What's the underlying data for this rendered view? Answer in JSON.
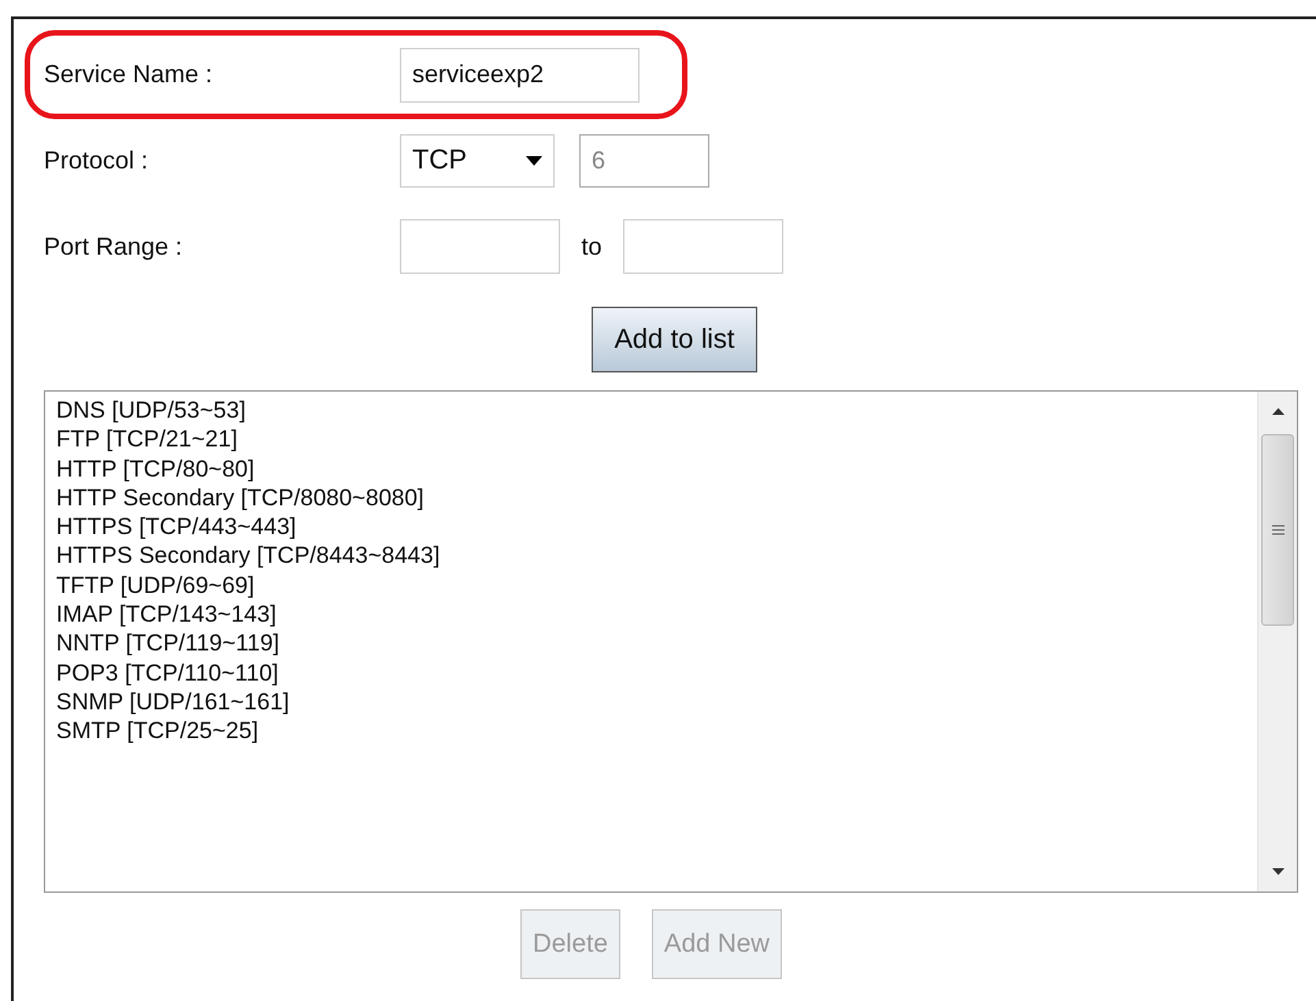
{
  "service_name": {
    "label": "Service Name :",
    "value": "serviceexp2",
    "highlighted": true
  },
  "protocol": {
    "label": "Protocol :",
    "value": "TCP",
    "number": "6",
    "number_disabled": true
  },
  "port_range": {
    "label": "Port Range :",
    "separator": "to"
  },
  "add_button": {
    "label": "Add to list",
    "disabled": false
  },
  "services": [
    "DNS [UDP/53~53]",
    "FTP [TCP/21~21]",
    "HTTP [TCP/80~80]",
    "HTTP Secondary [TCP/8080~8080]",
    "HTTPS [TCP/443~443]",
    "HTTPS Secondary [TCP/8443~8443]",
    "TFTP [UDP/69~69]",
    "IMAP [TCP/143~143]",
    "NNTP [TCP/119~119]",
    "POP3 [TCP/110~110]",
    "SNMP [UDP/161~161]",
    "SMTP [TCP/25~25]"
  ],
  "buttons": [
    {
      "label": "Delete",
      "disabled": true
    },
    {
      "label": "Add New",
      "disabled": true
    }
  ]
}
